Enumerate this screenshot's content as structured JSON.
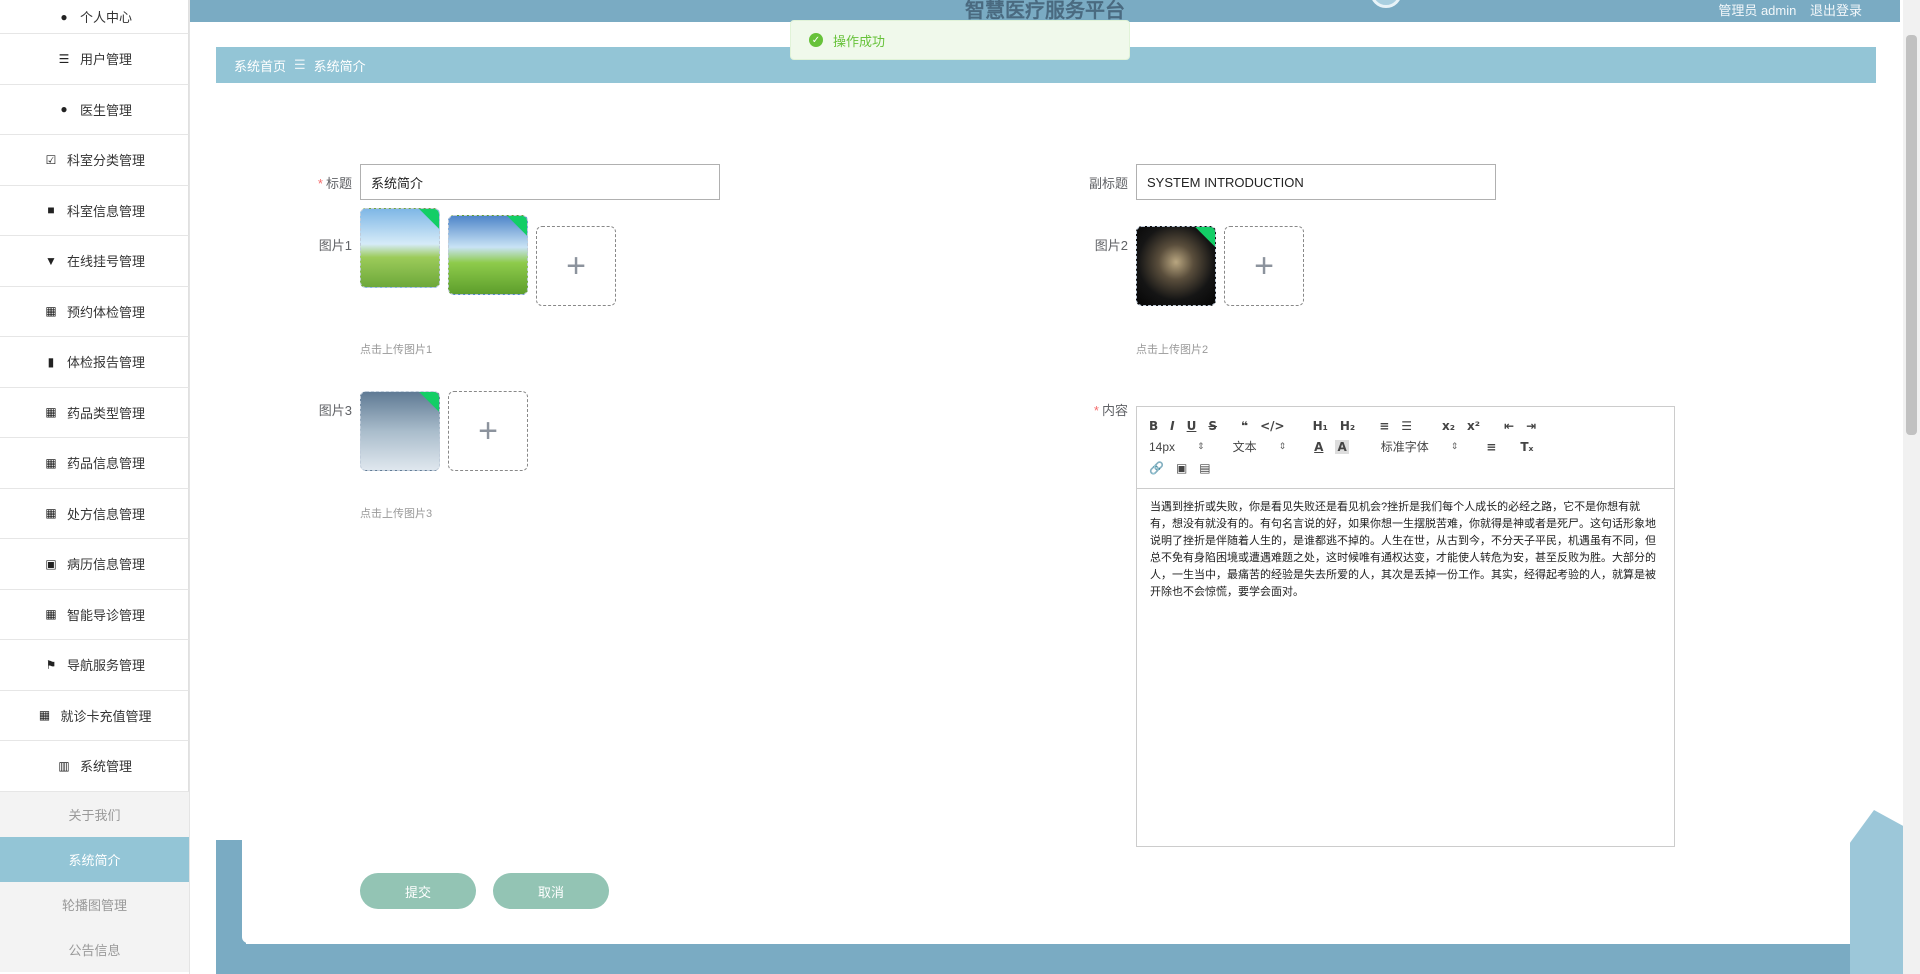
{
  "app": {
    "title": "智慧医疗服务平台",
    "user_label": "管理员 admin",
    "logout_label": "退出登录"
  },
  "toast": {
    "message": "操作成功"
  },
  "breadcrumb": [
    "系统首页",
    "系统简介"
  ],
  "sidebar": {
    "items": [
      {
        "label": "个人中心",
        "icon": "user-icon"
      },
      {
        "label": "用户管理",
        "icon": "list-icon"
      },
      {
        "label": "医生管理",
        "icon": "pin-icon"
      },
      {
        "label": "科室分类管理",
        "icon": "clipboard-icon"
      },
      {
        "label": "科室信息管理",
        "icon": "briefcase-icon"
      },
      {
        "label": "在线挂号管理",
        "icon": "brush-icon"
      },
      {
        "label": "预约体检管理",
        "icon": "grid-icon"
      },
      {
        "label": "体检报告管理",
        "icon": "books-icon"
      },
      {
        "label": "药品类型管理",
        "icon": "grid-icon"
      },
      {
        "label": "药品信息管理",
        "icon": "grid-icon"
      },
      {
        "label": "处方信息管理",
        "icon": "grid-icon"
      },
      {
        "label": "病历信息管理",
        "icon": "ticket-icon"
      },
      {
        "label": "智能导诊管理",
        "icon": "grid-icon"
      },
      {
        "label": "导航服务管理",
        "icon": "flag-icon"
      },
      {
        "label": "就诊卡充值管理",
        "icon": "grid-icon"
      },
      {
        "label": "系统管理",
        "icon": "bar-chart-icon"
      }
    ],
    "sub_items": [
      {
        "label": "关于我们",
        "active": false
      },
      {
        "label": "系统简介",
        "active": true
      },
      {
        "label": "轮播图管理",
        "active": false
      },
      {
        "label": "公告信息",
        "active": false
      }
    ]
  },
  "form": {
    "title_label": "标题",
    "title_value": "系统简介",
    "subtitle_label": "副标题",
    "subtitle_value": "SYSTEM INTRODUCTION",
    "image1_label": "图片1",
    "image1_hint": "点击上传图片1",
    "image2_label": "图片2",
    "image2_hint": "点击上传图片2",
    "image3_label": "图片3",
    "image3_hint": "点击上传图片3",
    "content_label": "内容",
    "content_text": "当遇到挫折或失败，你是看见失败还是看见机会?挫折是我们每个人成长的必经之路，它不是你想有就有，想没有就没有的。有句名言说的好，如果你想一生摆脱苦难，你就得是神或者是死尸。这句话形象地说明了挫折是伴随着人生的，是谁都逃不掉的。人生在世，从古到今，不分天子平民，机遇虽有不同，但总不免有身陷困境或遭遇难题之处，这时候唯有通权达变，才能使人转危为安，甚至反败为胜。大部分的人，一生当中，最痛苦的经验是失去所爱的人，其次是丢掉一份工作。其实，经得起考验的人，就算是被开除也不会惊慌，要学会面对。",
    "submit_label": "提交",
    "cancel_label": "取消"
  },
  "editor_toolbar": {
    "font_size": "14px",
    "block_type": "文本",
    "font_family": "标准字体"
  },
  "colors": {
    "accent": "#93c5d6",
    "topbar": "#7aabc3",
    "button": "#93c4b4",
    "success": "#67c23a"
  }
}
